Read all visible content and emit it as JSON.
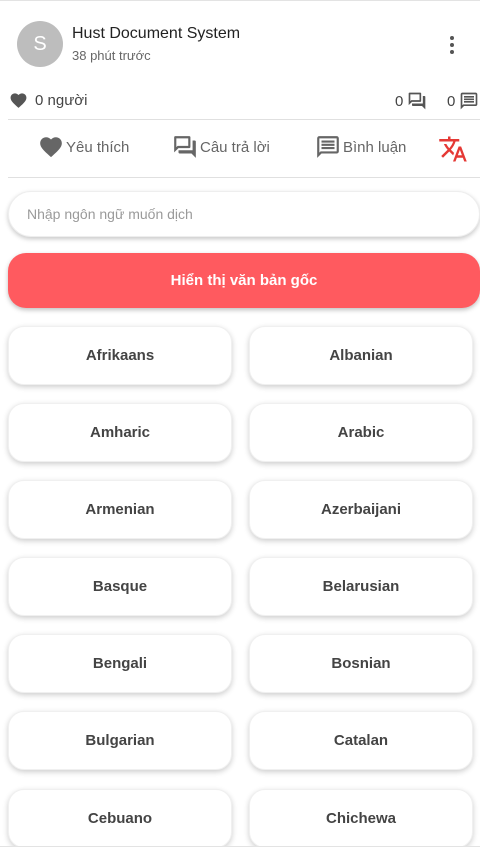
{
  "post": {
    "avatar_letter": "S",
    "author": "Hust Document System",
    "time": "38 phút trước"
  },
  "stats": {
    "likes": "0 người",
    "answers_count": "0",
    "comments_count": "0"
  },
  "actions": {
    "like_label": "Yêu thích",
    "answer_label": "Câu trả lời",
    "comment_label": "Bình luận",
    "translate_icon": "translate-icon"
  },
  "translate": {
    "search_placeholder": "Nhập ngôn ngữ muốn dịch",
    "original_label": "Hiển thị văn bản gốc",
    "languages": [
      "Afrikaans",
      "Albanian",
      "Amharic",
      "Arabic",
      "Armenian",
      "Azerbaijani",
      "Basque",
      "Belarusian",
      "Bengali",
      "Bosnian",
      "Bulgarian",
      "Catalan",
      "Cebuano",
      "Chichewa"
    ]
  },
  "colors": {
    "accent": "#ff5a5f",
    "translate_icon": "#e53935",
    "icon_gray": "#555555"
  }
}
